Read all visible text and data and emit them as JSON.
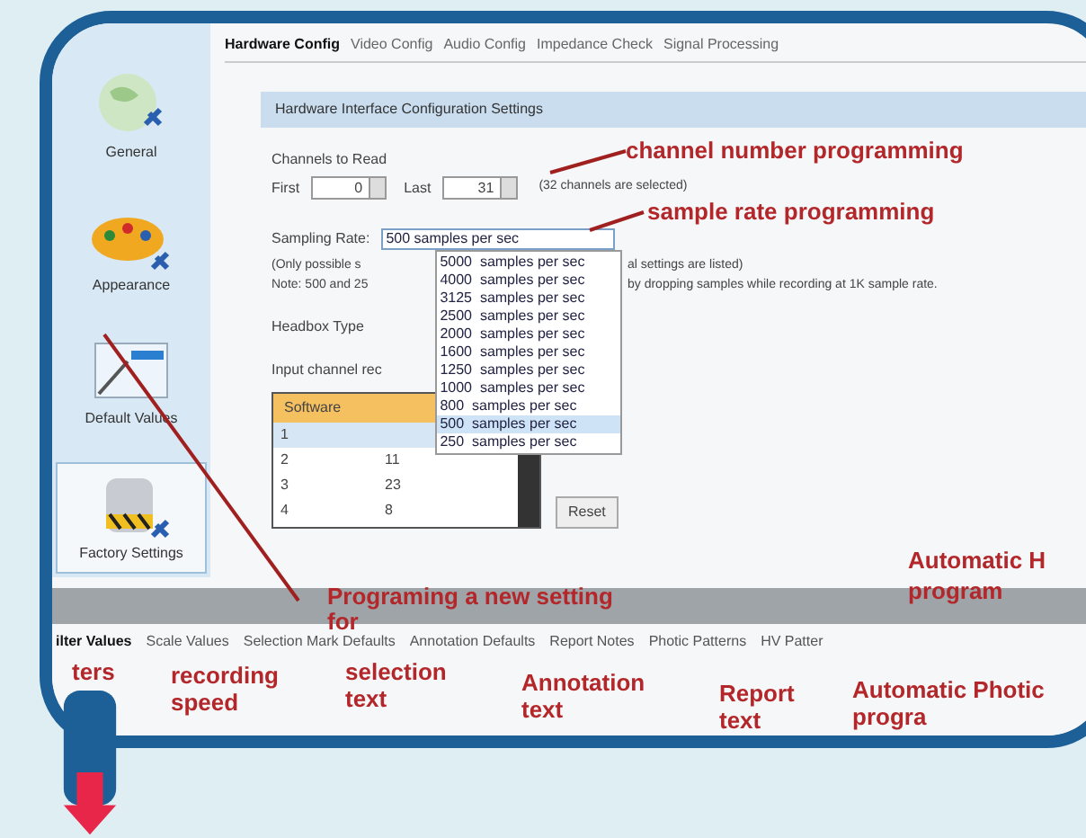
{
  "sidebar": {
    "items": [
      {
        "label": "General",
        "selected": false,
        "kind": "globe"
      },
      {
        "label": "Appearance",
        "selected": false,
        "kind": "palette"
      },
      {
        "label": "Default Values",
        "selected": false,
        "kind": "chart"
      },
      {
        "label": "Factory Settings",
        "selected": true,
        "kind": "drum"
      }
    ]
  },
  "tabs": [
    {
      "label": "Hardware Config",
      "selected": true
    },
    {
      "label": "Video Config",
      "selected": false
    },
    {
      "label": "Audio Config",
      "selected": false
    },
    {
      "label": "Impedance Check",
      "selected": false
    },
    {
      "label": "Signal Processing",
      "selected": false
    }
  ],
  "panel": {
    "title": "Hardware Interface Configuration Settings",
    "channels_label": "Channels to Read",
    "first_label": "First",
    "first_value": "0",
    "last_label": "Last",
    "last_value": "31",
    "channels_note": "(32 channels are selected)",
    "sampling_label": "Sampling Rate:",
    "sampling_value": "500  samples per sec",
    "sampling_options": [
      {
        "label": "5000  samples per sec",
        "selected": false
      },
      {
        "label": "4000  samples per sec",
        "selected": false
      },
      {
        "label": "3125  samples per sec",
        "selected": false
      },
      {
        "label": "2500  samples per sec",
        "selected": false
      },
      {
        "label": "2000  samples per sec",
        "selected": false
      },
      {
        "label": "1600  samples per sec",
        "selected": false
      },
      {
        "label": "1250  samples per sec",
        "selected": false
      },
      {
        "label": "1000  samples per sec",
        "selected": false
      },
      {
        "label": "800  samples per sec",
        "selected": false
      },
      {
        "label": "500  samples per sec",
        "selected": true
      },
      {
        "label": "250  samples per sec",
        "selected": false
      }
    ],
    "note_lines": [
      {
        "left": "(Only possible s",
        "right": "al settings are listed)"
      },
      {
        "left": "Note: 500 and 25",
        "right": "by dropping samples while recording at 1K sample rate."
      }
    ],
    "headbox_label": "Headbox Type",
    "input_label": "Input channel rec",
    "table": {
      "columns": [
        "Software"
      ],
      "rows": [
        {
          "cells": [
            "1"
          ],
          "selected": true
        },
        {
          "cells": [
            "2",
            "11"
          ],
          "selected": false
        },
        {
          "cells": [
            "3",
            "23"
          ],
          "selected": false
        },
        {
          "cells": [
            "4",
            "8"
          ],
          "selected": false
        }
      ]
    },
    "reset_button": "Reset"
  },
  "bottom_tabs": [
    {
      "label": "ilter Values",
      "selected": true
    },
    {
      "label": "Scale Values",
      "selected": false
    },
    {
      "label": "Selection Mark Defaults",
      "selected": false
    },
    {
      "label": "Annotation Defaults",
      "selected": false
    },
    {
      "label": "Report Notes",
      "selected": false
    },
    {
      "label": "Photic Patterns",
      "selected": false
    },
    {
      "label": "HV Patter",
      "selected": false
    }
  ],
  "annotations": [
    {
      "text": "channel number programming",
      "kind": "channel"
    },
    {
      "text": "sample rate programming",
      "kind": "rate"
    },
    {
      "text": "Programing a new setting",
      "kind": "setting"
    },
    {
      "text": "for",
      "kind": "setting2"
    },
    {
      "text": "Automatic H",
      "kind": "hv"
    },
    {
      "text": "program",
      "kind": "hv2"
    },
    {
      "text": "ters",
      "kind": "filter"
    },
    {
      "text": "recording speed",
      "kind": "scale"
    },
    {
      "text": "selection text",
      "kind": "selection"
    },
    {
      "text": "Annotation text",
      "kind": "annotation"
    },
    {
      "text": "Report text",
      "kind": "report"
    },
    {
      "text": "Automatic Photic progra",
      "kind": "photic"
    }
  ]
}
